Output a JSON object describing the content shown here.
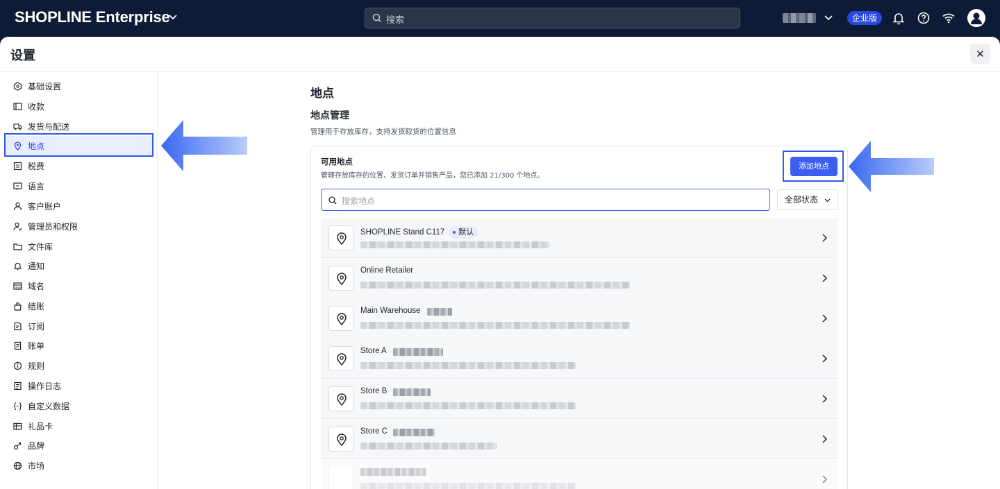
{
  "topbar": {
    "brand": "SHOPLINE Enterprise",
    "search_placeholder": "搜索",
    "plan_badge": "企业版"
  },
  "panel": {
    "title": "设置"
  },
  "sidebar": {
    "items": [
      {
        "label": "基础设置",
        "icon": "store-icon"
      },
      {
        "label": "收款",
        "icon": "payment-icon"
      },
      {
        "label": "发货与配送",
        "icon": "truck-icon"
      },
      {
        "label": "地点",
        "icon": "location-pin-icon",
        "active": true
      },
      {
        "label": "税费",
        "icon": "tax-icon"
      },
      {
        "label": "语言",
        "icon": "language-icon"
      },
      {
        "label": "客户账户",
        "icon": "user-icon"
      },
      {
        "label": "管理员和权限",
        "icon": "admin-icon"
      },
      {
        "label": "文件库",
        "icon": "folder-icon"
      },
      {
        "label": "通知",
        "icon": "bell-icon"
      },
      {
        "label": "域名",
        "icon": "domain-icon"
      },
      {
        "label": "结账",
        "icon": "bag-icon"
      },
      {
        "label": "订阅",
        "icon": "subscription-icon"
      },
      {
        "label": "账单",
        "icon": "bill-icon"
      },
      {
        "label": "规则",
        "icon": "info-icon"
      },
      {
        "label": "操作日志",
        "icon": "log-icon"
      },
      {
        "label": "自定义数据",
        "icon": "custom-data-icon"
      },
      {
        "label": "礼品卡",
        "icon": "gift-card-icon"
      },
      {
        "label": "品牌",
        "icon": "brand-icon"
      },
      {
        "label": "市场",
        "icon": "globe-icon"
      }
    ]
  },
  "main": {
    "title": "地点",
    "section_title": "地点管理",
    "section_desc": "管理用于存放库存，支持发货取货的位置信息",
    "card": {
      "title": "可用地点",
      "desc": "管理存放库存的位置、发货订单并销售产品，您已添加 21/300 个地点。",
      "add_button": "添加地点",
      "search_placeholder": "搜索地点",
      "status_filter": "全部状态",
      "default_tag": "默认"
    },
    "locations": [
      {
        "name": "SHOPLINE Stand C117",
        "default": true
      },
      {
        "name": "Online Retailer"
      },
      {
        "name": "Main Warehouse"
      },
      {
        "name": "Store A"
      },
      {
        "name": "Store B"
      },
      {
        "name": "Store C"
      },
      {
        "name": ""
      }
    ]
  },
  "colors": {
    "topbar_bg": "#0d1b36",
    "accent": "#3d5ef0",
    "highlight": "#2f5ae9"
  }
}
